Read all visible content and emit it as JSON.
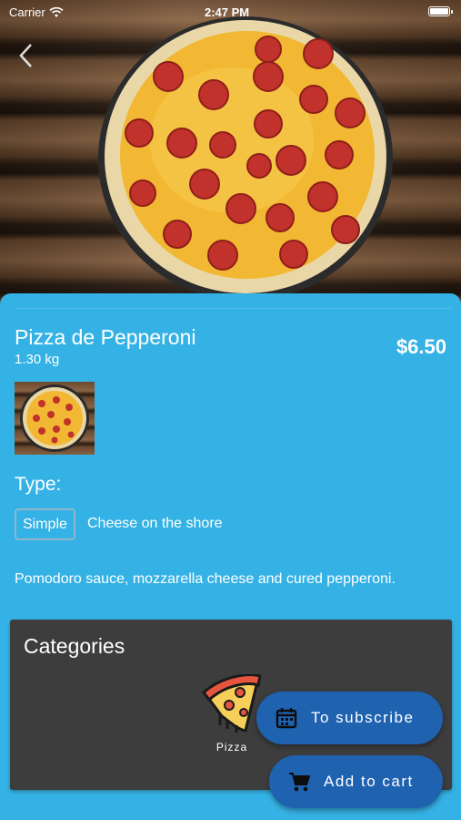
{
  "status_bar": {
    "carrier": "Carrier",
    "time": "2:47 PM"
  },
  "product": {
    "name": "Pizza de Pepperoni",
    "weight": "1.30 kg",
    "price": "$6.50",
    "type_label": "Type:",
    "type_chip": "Simple",
    "type_detail": "Cheese on the shore",
    "description": "Pomodoro sauce, mozzarella cheese and cured pepperoni."
  },
  "categories": {
    "title": "Categories",
    "items": [
      {
        "label": "Pizza",
        "icon": "pizza-slice-icon"
      }
    ]
  },
  "actions": {
    "subscribe_label": "To subscribe",
    "add_to_cart_label": "Add to cart"
  },
  "colors": {
    "background": "#35B2E5",
    "fab": "#1E62B0",
    "card": "#3D3D3D"
  }
}
